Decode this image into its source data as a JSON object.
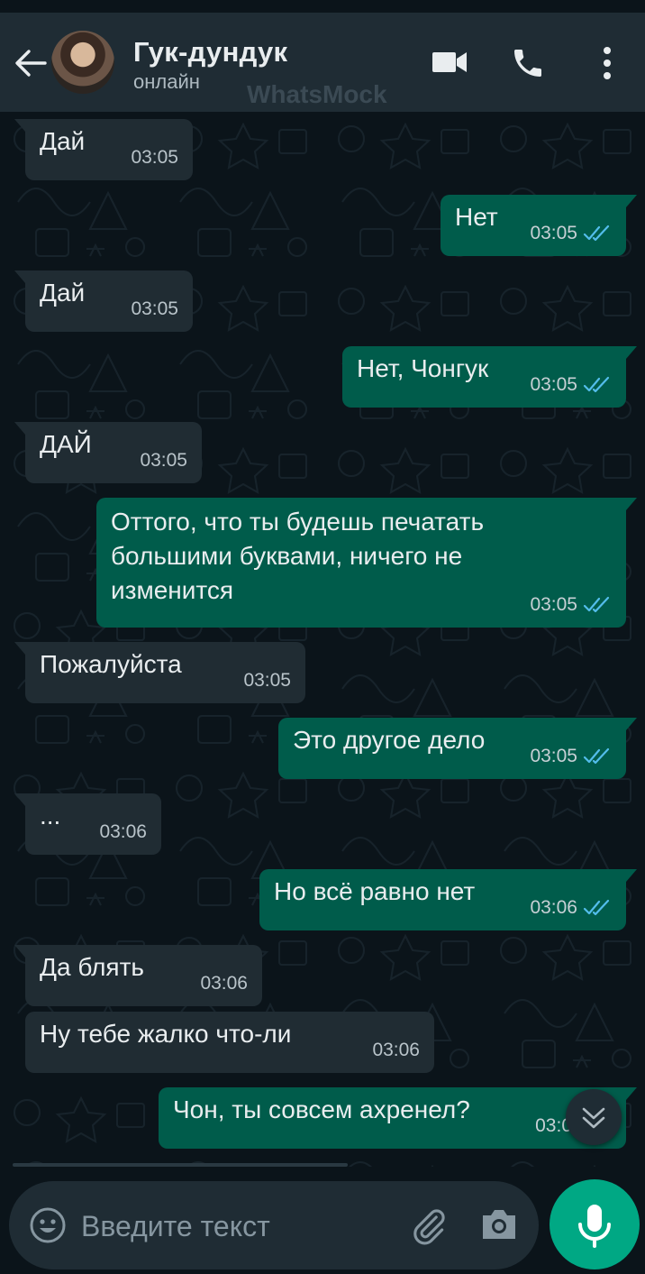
{
  "header": {
    "contact_name": "Гук-дундук",
    "status": "онлайн",
    "watermark": "WhatsMock"
  },
  "messages": [
    {
      "direction": "in",
      "text": "Дай",
      "time": "03:05"
    },
    {
      "direction": "out",
      "text": "Нет",
      "time": "03:05",
      "read": true
    },
    {
      "direction": "in",
      "text": "Дай",
      "time": "03:05"
    },
    {
      "direction": "out",
      "text": "Нет, Чонгук",
      "time": "03:05",
      "read": true
    },
    {
      "direction": "in",
      "text": "ДАЙ",
      "time": "03:05"
    },
    {
      "direction": "out",
      "text": "Оттого, что ты будешь печатать\nбольшими буквами, ничего не\nизменится",
      "time": "03:05",
      "read": true
    },
    {
      "direction": "in",
      "text": "Пожалуйста",
      "time": "03:05"
    },
    {
      "direction": "out",
      "text": "Это другое дело",
      "time": "03:05",
      "read": true
    },
    {
      "direction": "in",
      "text": "...",
      "time": "03:06"
    },
    {
      "direction": "out",
      "text": "Но всё равно нет",
      "time": "03:06",
      "read": true
    },
    {
      "direction": "in",
      "text": "Да блять",
      "time": "03:06"
    },
    {
      "direction": "in",
      "text": "Ну тебе жалко что-ли",
      "time": "03:06"
    },
    {
      "direction": "out",
      "text": "Чон, ты совсем ахренел?",
      "time": "03:0",
      "read": true
    }
  ],
  "composer": {
    "placeholder": "Введите текст"
  },
  "colors": {
    "header_bg": "#1f2c34",
    "chat_bg": "#0b141a",
    "incoming_bubble": "#202c33",
    "outgoing_bubble": "#005c4b",
    "accent": "#00a884",
    "read_tick": "#53bdeb"
  },
  "icons": {
    "back": "arrow-left-icon",
    "video": "video-call-icon",
    "call": "phone-icon",
    "menu": "more-vert-icon",
    "emoji": "emoji-icon",
    "attach": "paperclip-icon",
    "camera": "camera-icon",
    "mic": "mic-icon",
    "scroll": "chevron-double-down-icon"
  }
}
